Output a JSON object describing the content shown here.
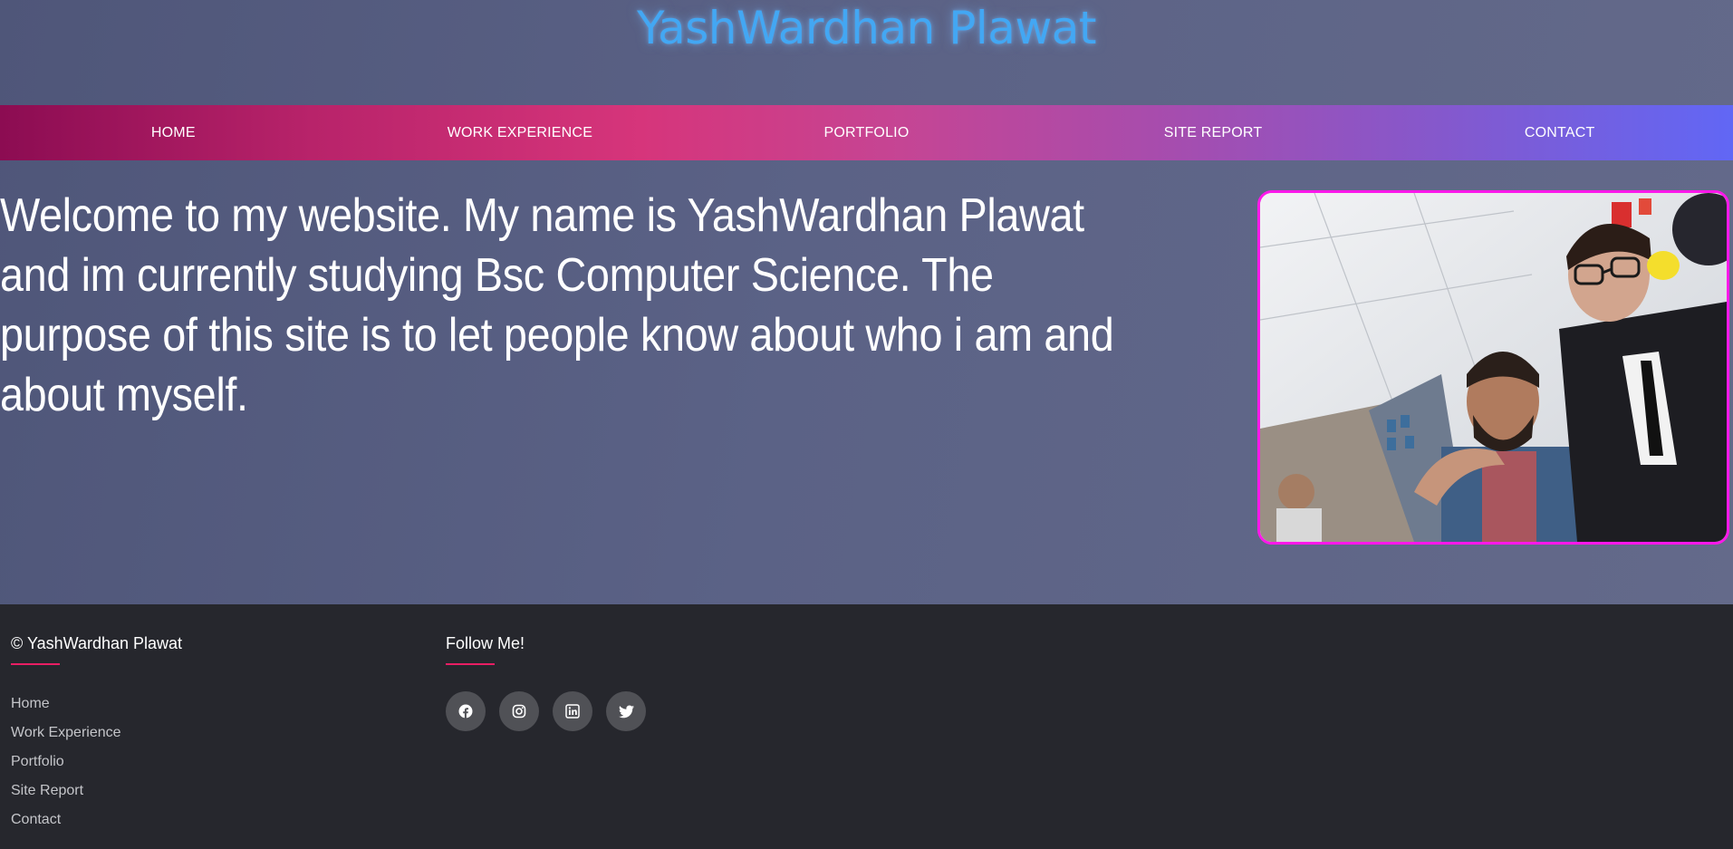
{
  "header": {
    "title": "YashWardhan Plawat"
  },
  "nav": {
    "items": [
      {
        "label": "HOME"
      },
      {
        "label": "WORK EXPERIENCE"
      },
      {
        "label": "PORTFOLIO"
      },
      {
        "label": "SITE REPORT"
      },
      {
        "label": "CONTACT"
      }
    ]
  },
  "main": {
    "welcome": "Welcome to my website. My name is YashWardhan Plawat and im currently studying Bsc Computer Science. The purpose of this site is to let people know about who i am and about myself.",
    "photo_icon": "profile-photo"
  },
  "footer": {
    "copyright": "© YashWardhan Plawat",
    "links": [
      "Home",
      "Work Experience",
      "Portfolio",
      "Site Report",
      "Contact"
    ],
    "follow_heading": "Follow Me!",
    "social": [
      {
        "icon": "facebook-icon"
      },
      {
        "icon": "instagram-icon"
      },
      {
        "icon": "linkedin-icon"
      },
      {
        "icon": "twitter-icon"
      }
    ]
  },
  "colors": {
    "title": "#43a7f3",
    "accent": "#e91e63",
    "photo_border": "#ff18ea",
    "footer_bg": "#26272d",
    "nav_start": "#8c0c52",
    "nav_end": "#6167f5"
  }
}
